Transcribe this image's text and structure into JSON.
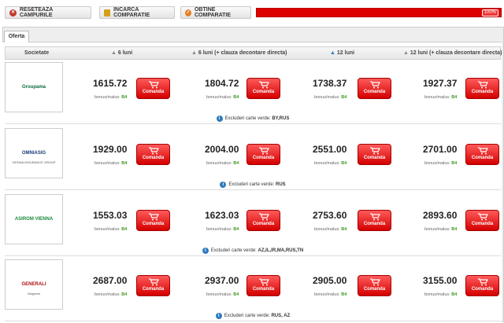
{
  "toolbar": {
    "reset_label": "RESETEAZA CAMPURILE",
    "load_label": "INCARCA COMPARATIE",
    "get_label": "OBTINE COMPARATIE",
    "progress_text": "100%",
    "progress_value": 1.0
  },
  "tabs": [
    {
      "label": "Oferta"
    }
  ],
  "header": {
    "col_company": "Societate",
    "col_6": "6 luni",
    "col_6d": "6 luni (+ clauza decontare directa)",
    "col_12": "12 luni",
    "col_12d": "12 luni (+ clauza decontare directa)"
  },
  "order_label": "Comanda",
  "bm_label": "bonus/malus:",
  "excl_label": "Excluderi carte verde:",
  "rows": [
    {
      "logo": "Groupama",
      "logo_color": "#0a6b3b",
      "prices": [
        "1615.72",
        "1804.72",
        "1738.37",
        "1927.37"
      ],
      "bm": [
        "B4",
        "B4",
        "B4",
        "B4"
      ],
      "excl": "BY,RUS"
    },
    {
      "logo": "OMNIASIG",
      "logo_sub": "VIENNA INSURANCE GROUP",
      "logo_color": "#1a3b7a",
      "prices": [
        "1929.00",
        "2004.00",
        "2551.00",
        "2701.00"
      ],
      "bm": [
        "B4",
        "B4",
        "B4",
        "B4"
      ],
      "excl": "RUS"
    },
    {
      "logo": "ASIROM VIENNA",
      "logo_color": "#1a8a3a",
      "prices": [
        "1553.03",
        "1623.03",
        "2753.60",
        "2893.60"
      ],
      "bm": [
        "B4",
        "B4",
        "B4",
        "B4"
      ],
      "excl": "AZ,IL,IR,MA,RUS,TN"
    },
    {
      "logo": "GENERALI",
      "logo_sub": "Asigurari",
      "logo_color": "#b01010",
      "prices": [
        "2687.00",
        "2937.00",
        "2905.00",
        "3155.00"
      ],
      "bm": [
        "B4",
        "B4",
        "B4",
        "B4"
      ],
      "excl": "RUS, AZ"
    }
  ]
}
